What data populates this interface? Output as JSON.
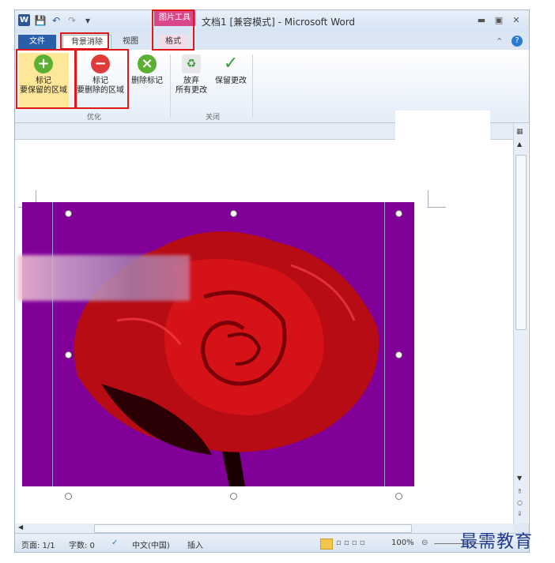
{
  "titlebar": {
    "app_icon": "W",
    "picture_tools_label": "图片工具",
    "title": "文档1 [兼容模式] - Microsoft Word",
    "qat_icons": [
      "word-logo-icon",
      "save-icon",
      "undo-icon",
      "redo-icon",
      "customize-icon"
    ]
  },
  "tabs": {
    "file": "文件",
    "background_removal": "背景消除",
    "view": "视图",
    "format": "格式"
  },
  "ribbon": {
    "mark_keep": {
      "line1": "标记",
      "line2": "要保留的区域"
    },
    "mark_remove": {
      "line1": "标记",
      "line2": "要删除的区域"
    },
    "delete_mark": "删除标记",
    "discard": {
      "line1": "放弃",
      "line2": "所有更改"
    },
    "keep_changes": "保留更改",
    "group_refine": "优化",
    "group_close": "关闭"
  },
  "statusbar": {
    "page": "页面: 1/1",
    "words": "字数: 0",
    "language": "中文(中国)",
    "insert": "插入",
    "zoom": "100%"
  },
  "watermark": "最需教育",
  "colors": {
    "image_bg": "#800098",
    "rose": "#d41218",
    "highlight": "#e01818",
    "file_tab": "#2a5ea8",
    "picture_tools": "#d9468a"
  }
}
